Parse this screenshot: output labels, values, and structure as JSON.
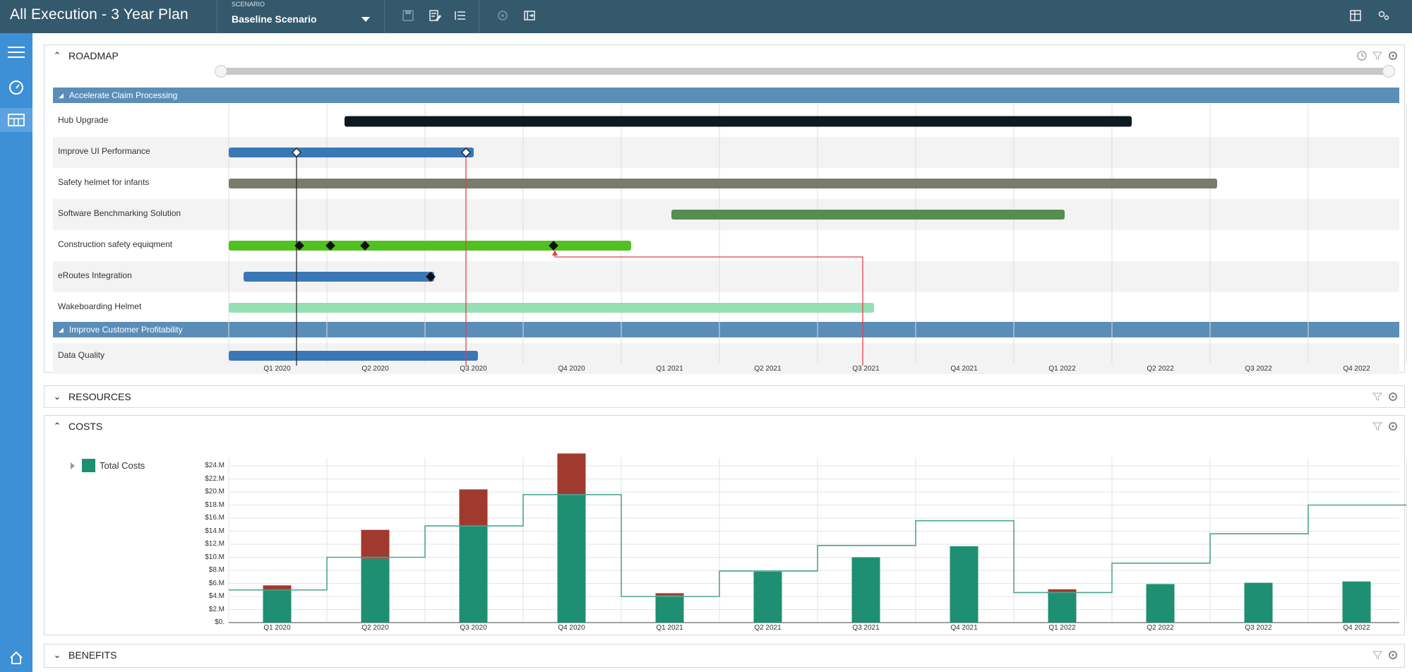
{
  "app": {
    "title": "All Execution - 3 Year Plan"
  },
  "scenario": {
    "caption": "SCENARIO",
    "value": "Baseline Scenario"
  },
  "panels": {
    "roadmap": {
      "title": "ROADMAP"
    },
    "resources": {
      "title": "RESOURCES"
    },
    "costs": {
      "title": "COSTS"
    },
    "benefits": {
      "title": "BENEFITS"
    }
  },
  "roadmap": {
    "groups": [
      {
        "label": "Accelerate Claim Processing"
      },
      {
        "label": "Improve Customer Profitability"
      }
    ],
    "rows": [
      {
        "label": "Hub Upgrade",
        "color": "#0e1a1f",
        "start": "Q2 2020 (mid)",
        "end": "Q2 2022 (mid)"
      },
      {
        "label": "Improve UI Performance",
        "color": "#3a78b5"
      },
      {
        "label": "Safety helmet for infants",
        "color": "#787c6a"
      },
      {
        "label": "Software Benchmarking Solution",
        "color": "#548f4f"
      },
      {
        "label": "Construction safety equiqment",
        "color": "#50c21f"
      },
      {
        "label": "eRoutes Integration",
        "color": "#3a78b5"
      },
      {
        "label": "Wakeboarding Helmet",
        "color": "#95dfb2"
      },
      {
        "label": "Data Quality",
        "color": "#3a78b5"
      }
    ],
    "quarters": [
      "Q1 2020",
      "Q2 2020",
      "Q3 2020",
      "Q4 2020",
      "Q1 2021",
      "Q2 2021",
      "Q3 2021",
      "Q4 2021",
      "Q1 2022",
      "Q2 2022",
      "Q3 2022",
      "Q4 2022"
    ]
  },
  "legend": {
    "label": "Total Costs",
    "color": "#1e8f72"
  },
  "chart_data": {
    "type": "bar",
    "title": "",
    "categories": [
      "Q1 2020",
      "Q2 2020",
      "Q3 2020",
      "Q4 2020",
      "Q1 2021",
      "Q2 2021",
      "Q3 2021",
      "Q4 2021",
      "Q1 2022",
      "Q2 2022",
      "Q3 2022",
      "Q4 2022"
    ],
    "series": [
      {
        "name": "Total Costs",
        "color": "#1e8f72",
        "values": [
          5.0,
          9.8,
          14.8,
          19.6,
          4.2,
          7.8,
          10.0,
          11.7,
          4.7,
          5.9,
          6.1,
          6.3
        ]
      },
      {
        "color": "#a03a2e",
        "values": [
          0.7,
          4.4,
          5.6,
          6.3,
          0.3,
          0,
          0,
          0,
          0.4,
          0,
          0,
          0
        ]
      },
      {
        "type": "step",
        "color": "#4aa595",
        "values": [
          5.0,
          10.0,
          14.8,
          19.6,
          4.0,
          7.9,
          11.8,
          15.6,
          4.6,
          9.1,
          13.6,
          18.0
        ]
      }
    ],
    "yticks": [
      "$0.",
      "$2.M",
      "$4.M",
      "$6.M",
      "$8.M",
      "$10.M",
      "$12.M",
      "$14.M",
      "$16.M",
      "$18.M",
      "$20.M",
      "$22.M",
      "$24.M"
    ],
    "ylim": [
      0,
      24
    ],
    "grid": true,
    "legend": "left"
  }
}
